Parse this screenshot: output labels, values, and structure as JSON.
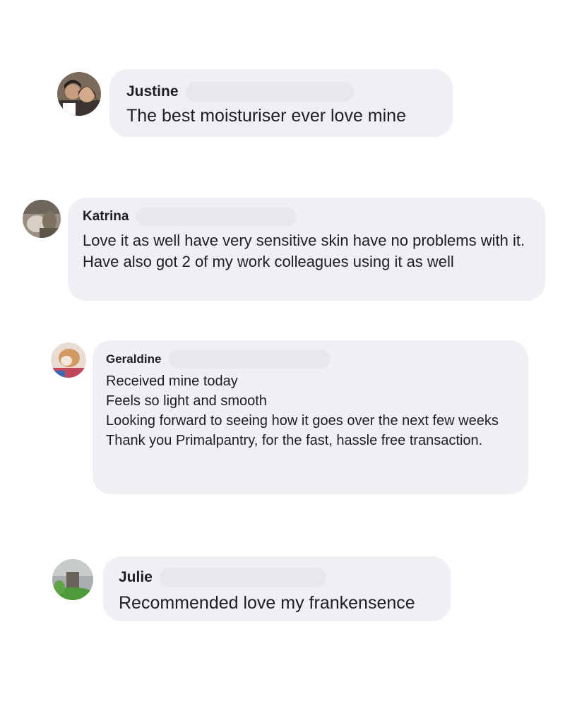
{
  "comments": [
    {
      "author": "Justine",
      "text": "The best moisturiser ever love mine",
      "avatar_icon": "user-photo-couple"
    },
    {
      "author": "Katrina",
      "text": "Love it as well have very sensitive skin have no problems with it. Have also got 2 of my work colleagues using it as well",
      "avatar_icon": "user-photo-animal"
    },
    {
      "author": "Geraldine",
      "text": "Received mine today\nFeels so light and smooth\nLooking forward to seeing how it goes over the next few weeks\nThank you Primalpantry, for the fast, hassle free transaction.",
      "avatar_icon": "user-photo-pet"
    },
    {
      "author": "Julie",
      "text": "Recommended love my frankensence",
      "avatar_icon": "user-photo-garden"
    }
  ],
  "colors": {
    "bubble_background": "#eff0f4",
    "text": "#1c1e21",
    "page_background": "#ffffff"
  }
}
